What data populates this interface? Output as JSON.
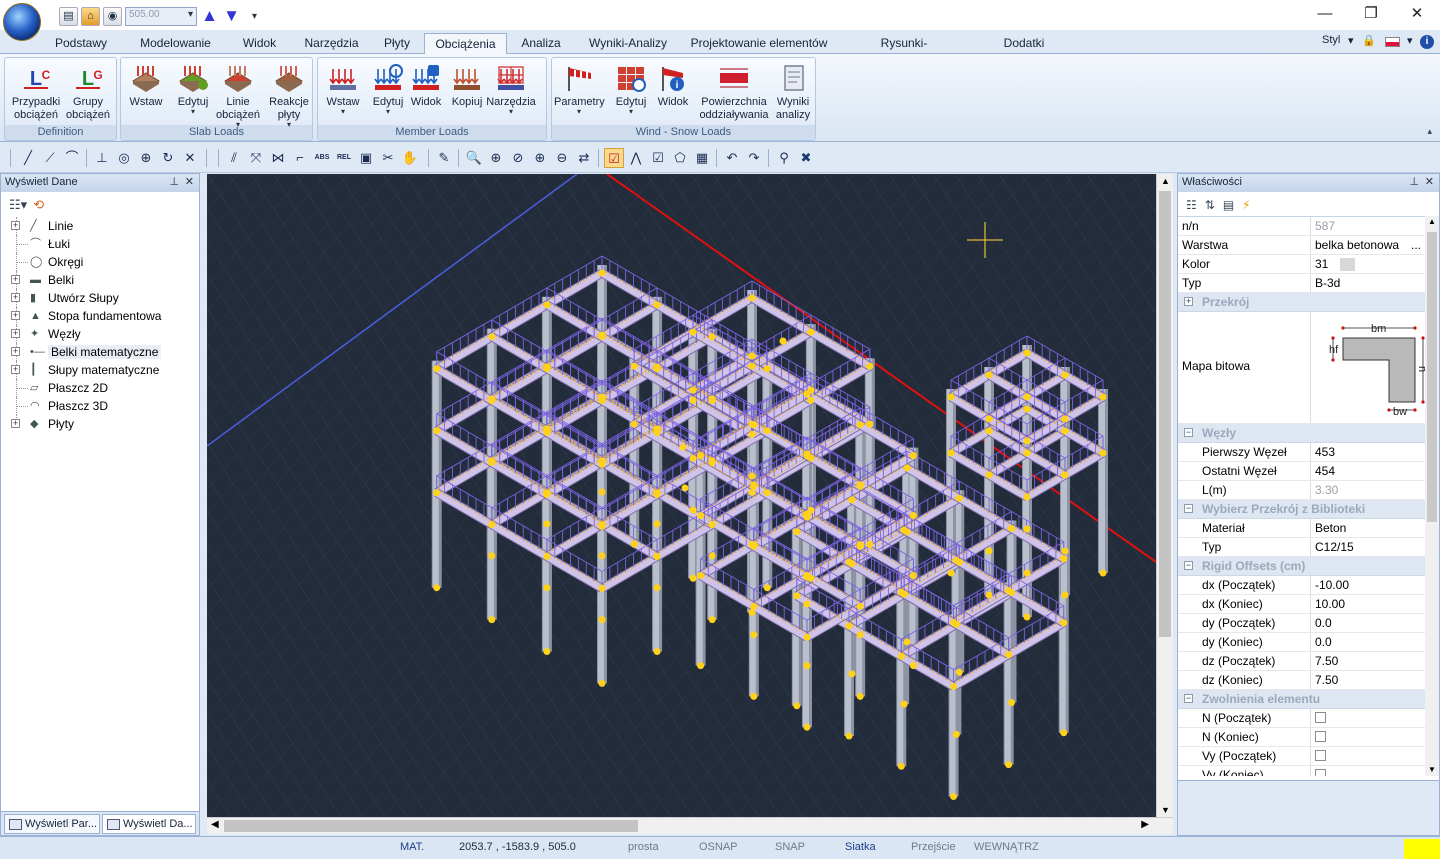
{
  "quick_access": {
    "combo_value": "505.00"
  },
  "tabs": [
    {
      "label": "Podstawy"
    },
    {
      "label": "Modelowanie"
    },
    {
      "label": "Widok"
    },
    {
      "label": "Narzędzia"
    },
    {
      "label": "Płyty"
    },
    {
      "label": "Obciążenia",
      "active": true
    },
    {
      "label": "Analiza"
    },
    {
      "label": "Wyniki-Analizy"
    },
    {
      "label": "Projektowanie elementów"
    },
    {
      "label": "Rysunki-Detalowanie"
    },
    {
      "label": "Dodatki"
    }
  ],
  "tab_right": {
    "style_label": "Styl"
  },
  "ribbon": {
    "groups": [
      {
        "label": "Definition",
        "buttons": [
          {
            "line1": "Przypadki",
            "line2": "obciążeń",
            "icon": "load-cases-icon"
          },
          {
            "line1": "Grupy",
            "line2": "obciążeń",
            "icon": "load-groups-icon"
          }
        ]
      },
      {
        "label": "Slab Loads",
        "buttons": [
          {
            "line1": "Wstaw",
            "icon": "slab-insert-icon"
          },
          {
            "line1": "Edytuj",
            "icon": "slab-edit-icon"
          },
          {
            "line1": "Linie",
            "line2": "obciążeń",
            "icon": "load-lines-icon"
          },
          {
            "line1": "Reakcje",
            "line2": "płyty",
            "icon": "slab-reactions-icon"
          }
        ]
      },
      {
        "label": "Member Loads",
        "buttons": [
          {
            "line1": "Wstaw",
            "icon": "member-insert-icon"
          },
          {
            "line1": "Edytuj",
            "icon": "member-edit-icon"
          },
          {
            "line1": "Widok",
            "icon": "member-view-icon"
          },
          {
            "line1": "Kopiuj",
            "icon": "member-copy-icon"
          },
          {
            "line1": "Narzędzia",
            "icon": "member-tools-icon"
          }
        ]
      },
      {
        "label": "Wind - Snow Loads",
        "buttons": [
          {
            "line1": "Parametry",
            "icon": "wind-params-icon"
          },
          {
            "line1": "Edytuj",
            "icon": "wind-edit-icon"
          },
          {
            "line1": "Widok",
            "icon": "wind-view-icon"
          },
          {
            "line1": "Powierzchnia",
            "line2": "oddziaływania",
            "icon": "action-surface-icon"
          },
          {
            "line1": "Wyniki",
            "line2": "analizy",
            "icon": "analysis-results-icon"
          }
        ]
      }
    ]
  },
  "left_panel": {
    "title": "Wyświetl Dane",
    "tree": [
      {
        "label": "Linie",
        "icon": "line-icon"
      },
      {
        "label": "Łuki",
        "icon": "arc-icon"
      },
      {
        "label": "Okręgi",
        "icon": "circle-icon"
      },
      {
        "label": "Belki",
        "icon": "beam-icon"
      },
      {
        "label": "Utwórz Słupy",
        "icon": "column-icon"
      },
      {
        "label": "Stopa fundamentowa",
        "icon": "footing-icon"
      },
      {
        "label": "Węzły",
        "icon": "node-icon"
      },
      {
        "label": "Belki matematyczne",
        "icon": "math-beam-icon"
      },
      {
        "label": "Słupy matematyczne",
        "icon": "math-column-icon"
      },
      {
        "label": "Płaszcz 2D",
        "icon": "shell-2d-icon"
      },
      {
        "label": "Płaszcz 3D",
        "icon": "shell-3d-icon"
      },
      {
        "label": "Płyty",
        "icon": "slab-icon"
      }
    ],
    "bottom_tabs": [
      {
        "label": "Wyświetl Par..."
      },
      {
        "label": "Wyświetl Da..."
      }
    ]
  },
  "right_panel": {
    "title": "Właściwości",
    "rows": [
      {
        "kind": "row",
        "key": "n/n",
        "value": "587",
        "gray": true
      },
      {
        "kind": "row",
        "key": "Warstwa",
        "value": "belka betonowa",
        "more": "..."
      },
      {
        "kind": "color",
        "key": "Kolor",
        "value": "31"
      },
      {
        "kind": "row",
        "key": "Typ",
        "value": "B-3d"
      },
      {
        "kind": "cat",
        "label": "Przekrój",
        "sign": "+"
      },
      {
        "kind": "bitmap",
        "key": "Mapa bitowa",
        "dims": {
          "top": "bm",
          "left": "hf",
          "right": "h",
          "bottom": "bw"
        }
      },
      {
        "kind": "cat",
        "label": "Węzły",
        "sign": "−"
      },
      {
        "kind": "row",
        "key": "Pierwszy Węzeł",
        "value": "453",
        "indent": true
      },
      {
        "kind": "row",
        "key": "Ostatni Węzeł",
        "value": "454",
        "indent": true
      },
      {
        "kind": "row",
        "key": "L(m)",
        "value": "3.30",
        "indent": true,
        "gray": true
      },
      {
        "kind": "cat",
        "label": "Wybierz Przekrój z Biblioteki",
        "sign": "−"
      },
      {
        "kind": "row",
        "key": "Materiał",
        "value": "Beton",
        "indent": true
      },
      {
        "kind": "row",
        "key": "Typ",
        "value": "C12/15",
        "indent": true
      },
      {
        "kind": "cat",
        "label": "Rigid Offsets (cm)",
        "sign": "−"
      },
      {
        "kind": "row",
        "key": "dx (Początek)",
        "value": "-10.00",
        "indent": true
      },
      {
        "kind": "row",
        "key": "dx (Koniec)",
        "value": "10.00",
        "indent": true
      },
      {
        "kind": "row",
        "key": "dy (Początek)",
        "value": "0.0",
        "indent": true
      },
      {
        "kind": "row",
        "key": "dy (Koniec)",
        "value": "0.0",
        "indent": true
      },
      {
        "kind": "row",
        "key": "dz (Początek)",
        "value": "7.50",
        "indent": true
      },
      {
        "kind": "row",
        "key": "dz (Koniec)",
        "value": "7.50",
        "indent": true
      },
      {
        "kind": "cat",
        "label": "Zwolnienia elementu",
        "sign": "−"
      },
      {
        "kind": "check",
        "key": "N (Początek)",
        "indent": true
      },
      {
        "kind": "check",
        "key": "N (Koniec)",
        "indent": true
      },
      {
        "kind": "check",
        "key": "Vy (Początek)",
        "indent": true
      },
      {
        "kind": "check",
        "key": "Vy (Koniec)",
        "indent": true
      }
    ]
  },
  "status": {
    "mat": "MAT.",
    "coords": "2053.7 , -1583.9 , 505.0",
    "items": [
      {
        "label": "prosta",
        "on": false
      },
      {
        "label": "OSNAP",
        "on": false
      },
      {
        "label": "SNAP",
        "on": false
      },
      {
        "label": "Siatka",
        "on": true
      },
      {
        "label": "Przejście",
        "on": false
      },
      {
        "label": "WEWNĄTRZ",
        "on": false
      }
    ]
  },
  "colors": {
    "viewport_bg": "#232c3b",
    "beam": "#cfc3ea",
    "column": "#b9bfcc",
    "load": "#7a62e0",
    "node": "#ffd21a",
    "axis_red": "#e01010",
    "axis_blue": "#4a5fe0",
    "accent_yellow": "#ffff00"
  }
}
